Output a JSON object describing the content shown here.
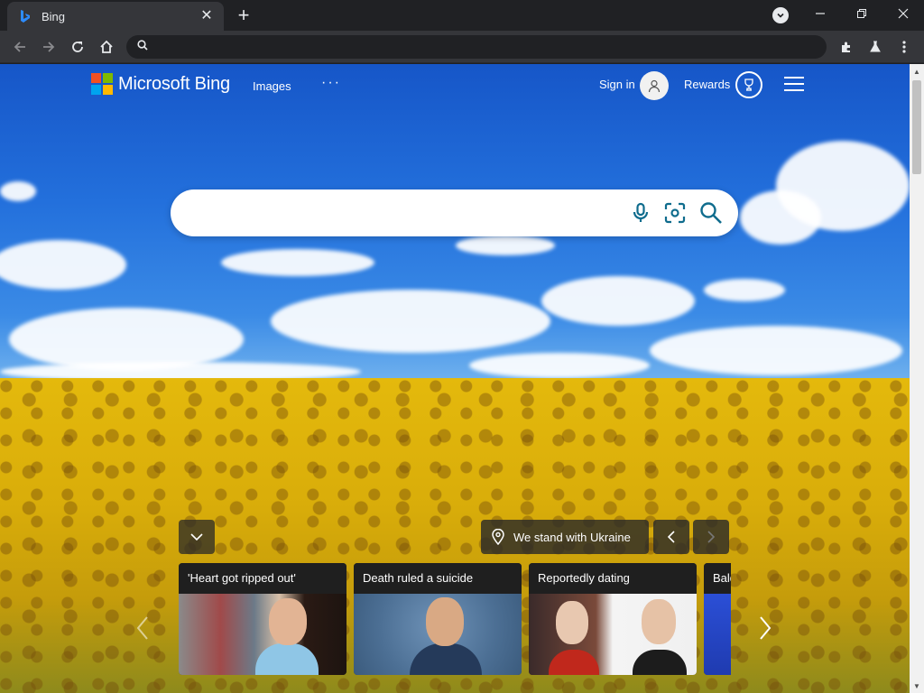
{
  "browser": {
    "tab_title": "Bing",
    "omnibox_value": "",
    "omnibox_placeholder": ""
  },
  "header": {
    "brand": "Microsoft Bing",
    "nav_images": "Images",
    "more": "···",
    "sign_in": "Sign in",
    "rewards": "Rewards"
  },
  "search": {
    "value": "",
    "placeholder": ""
  },
  "banner": {
    "ukraine_label": "We stand with Ukraine"
  },
  "cards": [
    {
      "title": "'Heart got ripped out'"
    },
    {
      "title": "Death ruled a suicide"
    },
    {
      "title": "Reportedly dating"
    },
    {
      "title": "Bald"
    }
  ],
  "colors": {
    "ms_red": "#f25022",
    "ms_green": "#7fba00",
    "ms_blue": "#00a4ef",
    "ms_yellow": "#ffb900",
    "bing_teal": "#0f6c8d"
  }
}
